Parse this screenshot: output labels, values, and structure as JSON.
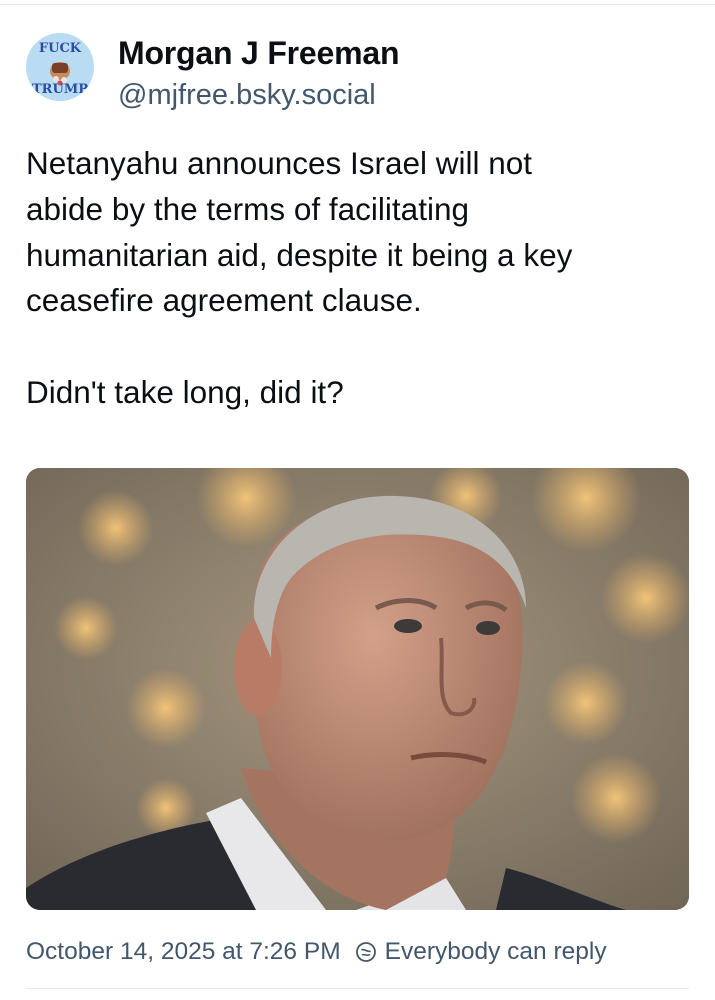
{
  "author": {
    "display_name": "Morgan J Freeman",
    "handle": "@mjfree.bsky.social",
    "avatar_text": "FUCK TRUMP"
  },
  "post": {
    "paragraphs": [
      "Netanyahu announces Israel will not\nabide by the terms of facilitating\nhumanitarian aid, despite it being a key\nceasefire agreement clause.",
      "Didn't take long, did it?"
    ]
  },
  "footer": {
    "timestamp": "October 14, 2025 at 7:26 PM",
    "reply_setting": "Everybody can reply",
    "reply_icon": "globe-check-icon"
  },
  "colors": {
    "text_primary": "#0b0f14",
    "text_secondary": "#42576c",
    "divider": "#e6e8eb",
    "avatar_bg": "#b9dcf2"
  }
}
